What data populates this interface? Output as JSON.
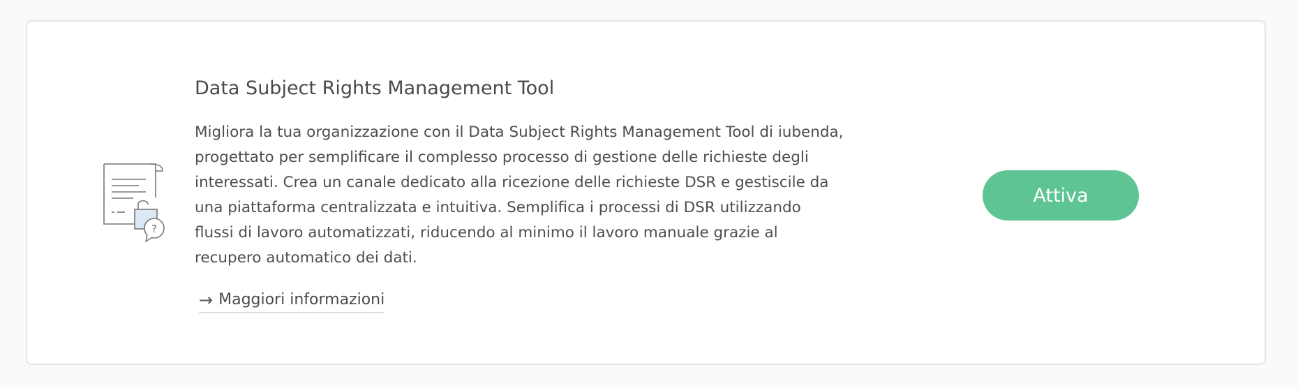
{
  "card": {
    "title": "Data Subject Rights Management Tool",
    "description": "Migliora la tua organizzazione con il Data Subject Rights Management Tool di iubenda, progettato per semplificare il complesso processo di gestione delle richieste degli interessati. Crea un canale dedicato alla ricezione delle richieste DSR e gestiscile da una piattaforma centralizzata e intuitiva. Semplifica i processi di DSR utilizzando flussi di lavoro automatizzati, riducendo al minimo il lavoro manuale grazie al recupero automatico dei dati.",
    "more_link_label": "Maggiori informazioni",
    "more_link_icon": "→",
    "action_label": "Attiva",
    "icon": "document-lock-question-icon"
  },
  "colors": {
    "action_button": "#5ec493",
    "icon_accent": "#dbe8f6",
    "card_border": "#e6e6e6",
    "page_background": "#fafafa"
  }
}
